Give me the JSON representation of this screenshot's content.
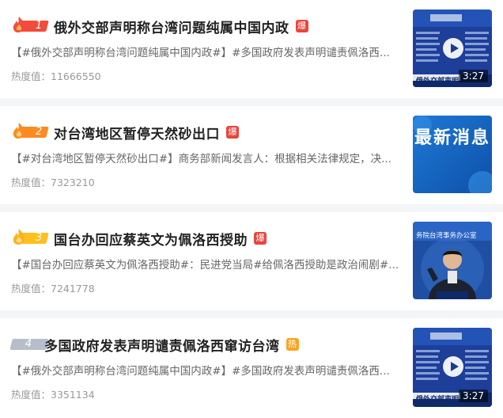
{
  "colors": {
    "rank1": "#f24c3d",
    "rank2": "#ff8a21",
    "rank3": "#ffc01e",
    "rank4": "#b8bec9",
    "tag_bao": "#e8453c",
    "tag_re": "#f6a623"
  },
  "items": [
    {
      "rank": "1",
      "title": "俄外交部声明称台湾问题纯属中国内政",
      "tag": "爆",
      "summary": "【#俄外交部声明称台湾问题纯属中国内政#】#多国政府发表声明谴责佩洛西...",
      "heat": "热度值：11666550",
      "duration": "3:27",
      "thumb_icon": "play-icon",
      "thumb_caption": "俄外交部声明"
    },
    {
      "rank": "2",
      "title": "对台湾地区暂停天然砂出口",
      "tag": "爆",
      "summary": "【#对台湾地区暂停天然砂出口#】商务部新闻发言人：根据相关法律规定，决...",
      "heat": "热度值：7323210",
      "thumb_text": "最新消息"
    },
    {
      "rank": "3",
      "title": "国台办回应蔡英文为佩洛西授助",
      "tag": "爆",
      "summary": "【#国台办回应蔡英文为佩洛西授助#：民进党当局#给佩洛西授助是政治闹剧#...",
      "heat": "热度值：7241778",
      "thumb_banner": "务院台湾事务办公室"
    },
    {
      "rank": "4",
      "title": "多国政府发表声明谴责佩洛西窜访台湾",
      "tag": "热",
      "summary": "【#俄外交部声明称台湾问题纯属中国内政#】#多国政府发表声明谴责佩洛西...",
      "heat": "热度值：3351134",
      "duration": "3:27",
      "thumb_icon": "play-icon",
      "thumb_caption": "俄外交部声明"
    }
  ]
}
